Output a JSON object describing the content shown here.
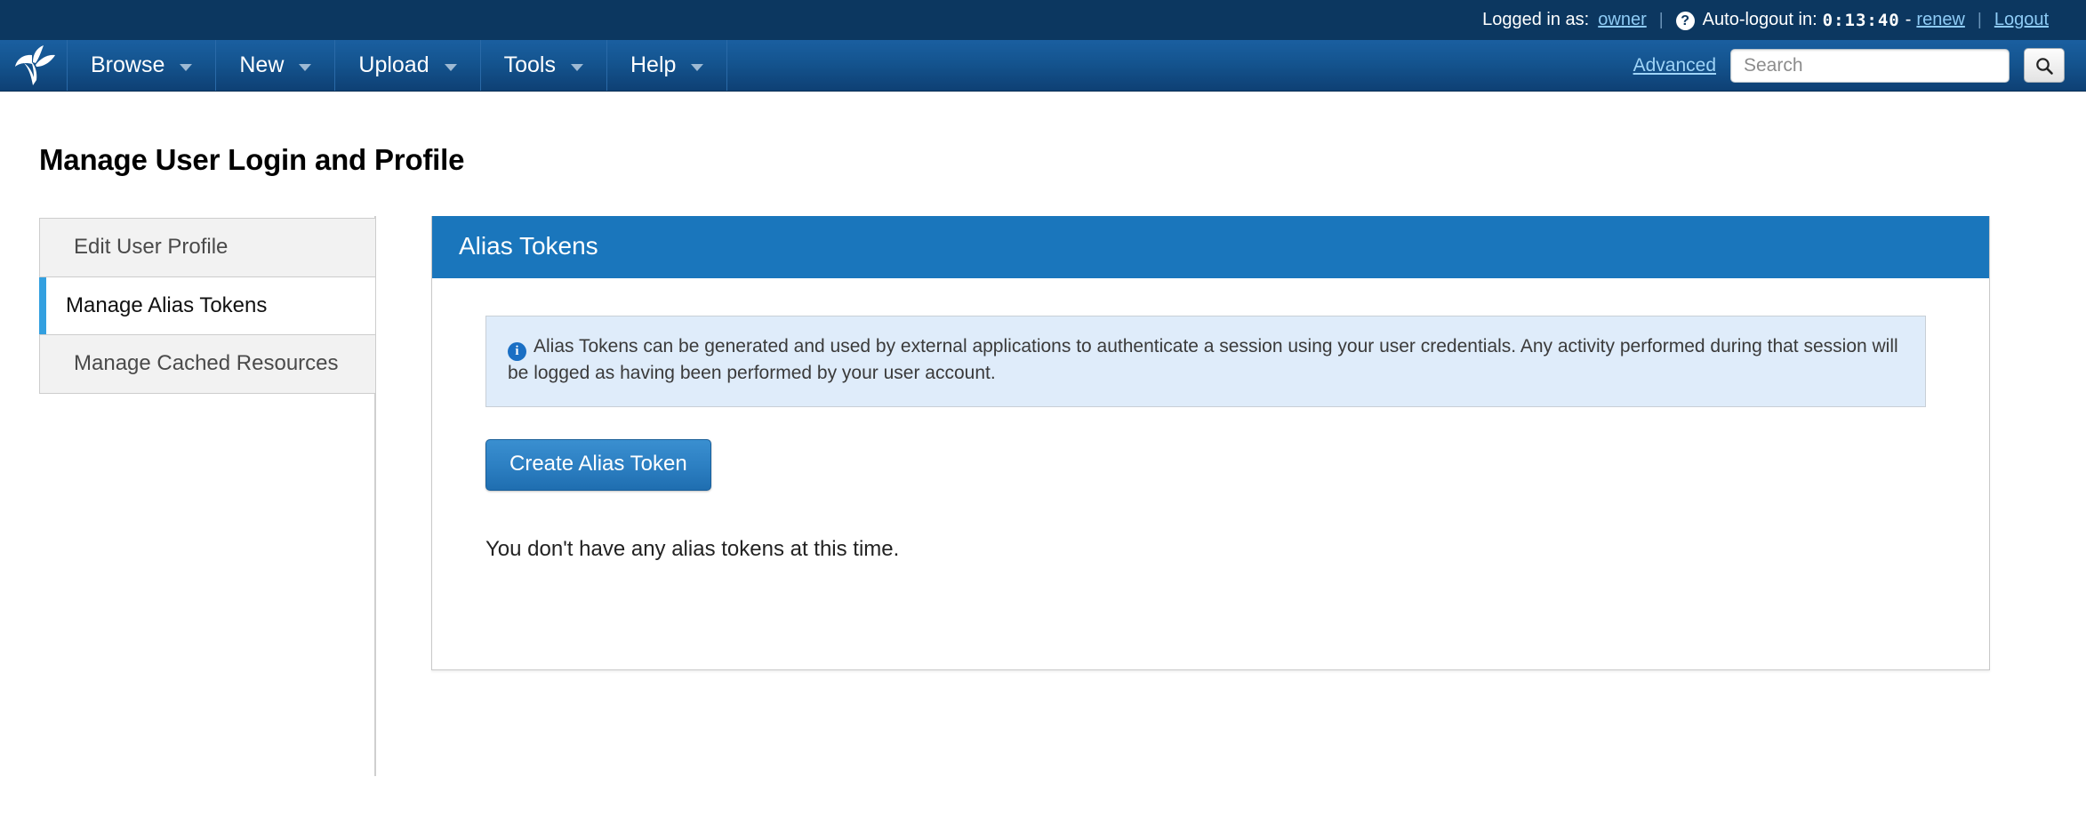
{
  "utility_bar": {
    "logged_in_label": "Logged in as:",
    "username": "owner",
    "separator": "|",
    "help_icon_glyph": "?",
    "autologout_label": "Auto-logout in:",
    "autologout_time": "0:13:40",
    "dash": "-",
    "renew_label": "renew",
    "logout_label": "Logout"
  },
  "navbar": {
    "logo_name": "xnat-leaf-logo",
    "items": [
      {
        "label": "Browse"
      },
      {
        "label": "New"
      },
      {
        "label": "Upload"
      },
      {
        "label": "Tools"
      },
      {
        "label": "Help"
      }
    ],
    "advanced_label": "Advanced",
    "search": {
      "placeholder": "Search",
      "value": "",
      "button_icon": "search-icon"
    }
  },
  "page": {
    "title": "Manage User Login and Profile"
  },
  "sidebar": {
    "items": [
      {
        "label": "Edit User Profile",
        "active": false
      },
      {
        "label": "Manage Alias Tokens",
        "active": true
      },
      {
        "label": "Manage Cached Resources",
        "active": false
      }
    ]
  },
  "panel": {
    "header": "Alias Tokens",
    "alert": {
      "icon": "info-icon",
      "icon_glyph": "i",
      "text": "Alias Tokens can be generated and used by external applications to authenticate a session using your user credentials. Any activity performed during that session will be logged as having been performed by your user account."
    },
    "create_button_label": "Create Alias Token",
    "empty_message": "You don't have any alias tokens at this time."
  },
  "colors": {
    "utility_bar_bg": "#0c3760",
    "navbar_bg": "#14548f",
    "panel_header_bg": "#1a76bc",
    "accent_blue": "#33a0e0",
    "link_blue": "#8ecbf5",
    "alert_bg": "#dfecfa",
    "button_blue": "#2d80c3"
  }
}
